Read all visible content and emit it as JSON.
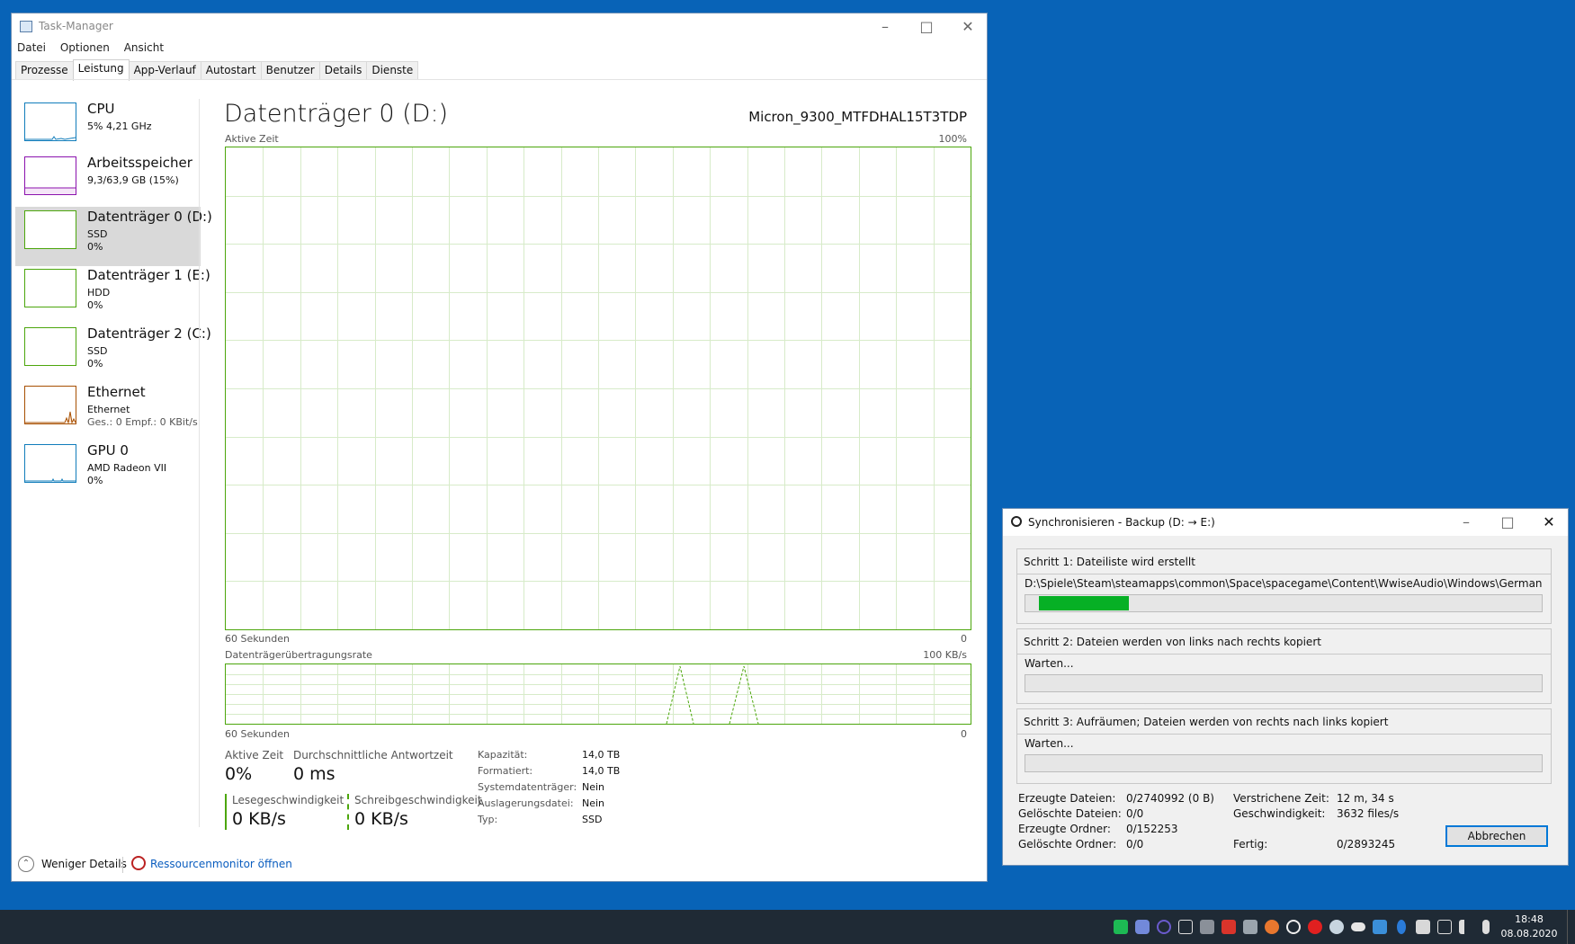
{
  "taskmanager": {
    "title": "Task-Manager",
    "menu": [
      "Datei",
      "Optionen",
      "Ansicht"
    ],
    "tabs": [
      "Prozesse",
      "Leistung",
      "App-Verlauf",
      "Autostart",
      "Benutzer",
      "Details",
      "Dienste"
    ],
    "active_tab": "Leistung",
    "sidebar": [
      {
        "name": "CPU",
        "sub": "5% 4,21 GHz",
        "sub2": "",
        "color": "#117dbb"
      },
      {
        "name": "Arbeitsspeicher",
        "sub": "9,3/63,9 GB (15%)",
        "sub2": "",
        "color": "#8b12ae"
      },
      {
        "name": "Datenträger 0 (D:)",
        "sub": "SSD",
        "sub2": "0%",
        "color": "#4ca60c"
      },
      {
        "name": "Datenträger 1 (E:)",
        "sub": "HDD",
        "sub2": "0%",
        "color": "#4ca60c"
      },
      {
        "name": "Datenträger 2 (C:)",
        "sub": "SSD",
        "sub2": "0%",
        "color": "#4ca60c"
      },
      {
        "name": "Ethernet",
        "sub": "Ethernet",
        "sub2": "Ges.: 0 Empf.: 0 KBit/s",
        "color": "#a74f01"
      },
      {
        "name": "GPU 0",
        "sub": "AMD Radeon VII",
        "sub2": "0%",
        "color": "#117dbb"
      }
    ],
    "main": {
      "heading": "Datenträger 0 (D:)",
      "model": "Micron_9300_MTFDHAL15T3TDP",
      "graph1_label": "Aktive Zeit",
      "graph1_max": "100%",
      "graph1_xl": "60 Sekunden",
      "graph1_xr": "0",
      "graph2_label": "Datenträgerübertragungsrate",
      "graph2_max": "100 KB/s",
      "graph2_xl": "60 Sekunden",
      "graph2_xr": "0",
      "active_time_label": "Aktive Zeit",
      "active_time_value": "0%",
      "response_label": "Durchschnittliche Antwortzeit",
      "response_value": "0 ms",
      "read_label": "Lesegeschwindigkeit",
      "read_value": "0 KB/s",
      "write_label": "Schreibgeschwindigkeit",
      "write_value": "0 KB/s",
      "props": [
        {
          "k": "Kapazität:",
          "v": "14,0 TB"
        },
        {
          "k": "Formatiert:",
          "v": "14,0 TB"
        },
        {
          "k": "Systemdatenträger:",
          "v": "Nein"
        },
        {
          "k": "Auslagerungsdatei:",
          "v": "Nein"
        },
        {
          "k": "Typ:",
          "v": "SSD"
        }
      ]
    },
    "footer": {
      "less": "Weniger Details",
      "resmon": "Ressourcenmonitor öffnen"
    },
    "accent": "#4ca60c"
  },
  "sync": {
    "title": "Synchronisieren - Backup (D: → E:)",
    "step1_title": "Schritt 1: Dateiliste wird erstellt",
    "step1_path": "D:\\Spiele\\Steam\\steamapps\\common\\Space\\spacegame\\Content\\WwiseAudio\\Windows\\German",
    "step1_progress": 0.2,
    "step2_title": "Schritt 2: Dateien werden von links nach rechts kopiert",
    "step2_status": "Warten...",
    "step3_title": "Schritt 3: Aufräumen; Dateien werden von rechts nach links kopiert",
    "step3_status": "Warten...",
    "stats": [
      {
        "k": "Erzeugte Dateien:",
        "v": "0/2740992 (0 B)"
      },
      {
        "k": "Gelöschte Dateien:",
        "v": "0/0"
      },
      {
        "k": "Erzeugte Ordner:",
        "v": "0/152253"
      },
      {
        "k": "Gelöschte Ordner:",
        "v": "0/0"
      }
    ],
    "stats_right": [
      {
        "k": "Verstrichene Zeit:",
        "v": "12 m, 34 s"
      },
      {
        "k": "Geschwindigkeit:",
        "v": "3632 files/s"
      },
      {
        "k": "Fertig:",
        "v": "0/2893245"
      }
    ],
    "cancel_label": "Abbrechen",
    "progress_color": "#06b025"
  },
  "taskbar": {
    "time": "18:48",
    "date": "08.08.2020"
  }
}
